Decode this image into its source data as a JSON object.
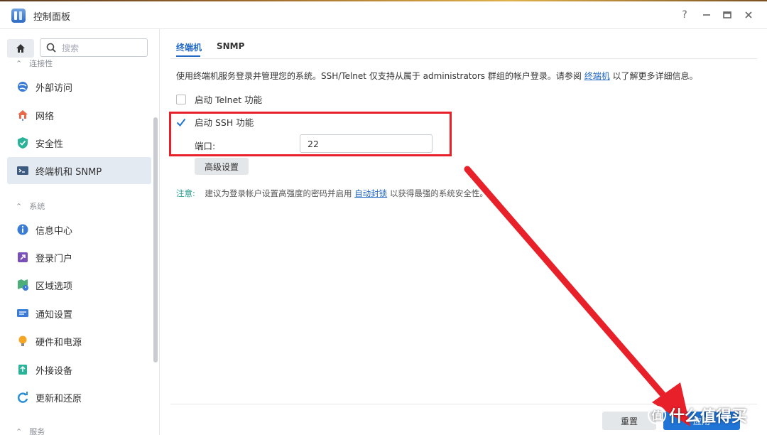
{
  "window": {
    "title": "控制面板"
  },
  "sidebar": {
    "search_placeholder": "搜索",
    "cat_connectivity": "连接性",
    "cat_system": "系统",
    "cat_services": "服务",
    "items": [
      {
        "label": "外部访问",
        "icon": "globe-icon"
      },
      {
        "label": "网络",
        "icon": "network-house-icon"
      },
      {
        "label": "安全性",
        "icon": "shield-check-icon"
      },
      {
        "label": "终端机和 SNMP",
        "icon": "terminal-icon"
      },
      {
        "label": "信息中心",
        "icon": "info-icon"
      },
      {
        "label": "登录门户",
        "icon": "login-portal-icon"
      },
      {
        "label": "区域选项",
        "icon": "region-icon"
      },
      {
        "label": "通知设置",
        "icon": "notification-icon"
      },
      {
        "label": "硬件和电源",
        "icon": "bulb-icon"
      },
      {
        "label": "外接设备",
        "icon": "external-device-icon"
      },
      {
        "label": "更新和还原",
        "icon": "update-icon"
      }
    ]
  },
  "tabs": [
    {
      "label": "终端机"
    },
    {
      "label": "SNMP"
    }
  ],
  "content": {
    "desc_prefix": "使用终端机服务登录并管理您的系统。SSH/Telnet 仅支持从属于 administrators 群组的帐户登录。请参阅",
    "desc_link": "终端机",
    "desc_suffix": "以了解更多详细信息。",
    "telnet_label": "启动 Telnet 功能",
    "telnet_checked": false,
    "ssh_label": "启动 SSH 功能",
    "ssh_checked": true,
    "port_label": "端口:",
    "port_value": "22",
    "advanced_button": "高级设置",
    "note_label": "注意:",
    "note_prefix": "建议为登录帐户设置高强度的密码并启用",
    "note_link": "自动封锁",
    "note_suffix": "以获得最强的系统安全性。"
  },
  "footer": {
    "reset_label": "重置",
    "apply_label": "应用"
  },
  "watermark": "什么值得买",
  "colors": {
    "accent": "#2268c4",
    "annotation_red": "#e8202a",
    "apply_blue": "#1f74d6"
  }
}
